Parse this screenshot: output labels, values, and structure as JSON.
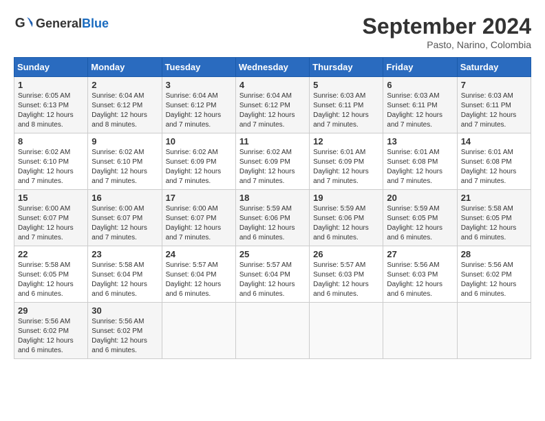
{
  "logo": {
    "general": "General",
    "blue": "Blue"
  },
  "title": "September 2024",
  "subtitle": "Pasto, Narino, Colombia",
  "days_of_week": [
    "Sunday",
    "Monday",
    "Tuesday",
    "Wednesday",
    "Thursday",
    "Friday",
    "Saturday"
  ],
  "weeks": [
    [
      {
        "day": "1",
        "sunrise": "6:05 AM",
        "sunset": "6:13 PM",
        "daylight": "12 hours and 8 minutes."
      },
      {
        "day": "2",
        "sunrise": "6:04 AM",
        "sunset": "6:12 PM",
        "daylight": "12 hours and 8 minutes."
      },
      {
        "day": "3",
        "sunrise": "6:04 AM",
        "sunset": "6:12 PM",
        "daylight": "12 hours and 7 minutes."
      },
      {
        "day": "4",
        "sunrise": "6:04 AM",
        "sunset": "6:12 PM",
        "daylight": "12 hours and 7 minutes."
      },
      {
        "day": "5",
        "sunrise": "6:03 AM",
        "sunset": "6:11 PM",
        "daylight": "12 hours and 7 minutes."
      },
      {
        "day": "6",
        "sunrise": "6:03 AM",
        "sunset": "6:11 PM",
        "daylight": "12 hours and 7 minutes."
      },
      {
        "day": "7",
        "sunrise": "6:03 AM",
        "sunset": "6:11 PM",
        "daylight": "12 hours and 7 minutes."
      }
    ],
    [
      {
        "day": "8",
        "sunrise": "6:02 AM",
        "sunset": "6:10 PM",
        "daylight": "12 hours and 7 minutes."
      },
      {
        "day": "9",
        "sunrise": "6:02 AM",
        "sunset": "6:10 PM",
        "daylight": "12 hours and 7 minutes."
      },
      {
        "day": "10",
        "sunrise": "6:02 AM",
        "sunset": "6:09 PM",
        "daylight": "12 hours and 7 minutes."
      },
      {
        "day": "11",
        "sunrise": "6:02 AM",
        "sunset": "6:09 PM",
        "daylight": "12 hours and 7 minutes."
      },
      {
        "day": "12",
        "sunrise": "6:01 AM",
        "sunset": "6:09 PM",
        "daylight": "12 hours and 7 minutes."
      },
      {
        "day": "13",
        "sunrise": "6:01 AM",
        "sunset": "6:08 PM",
        "daylight": "12 hours and 7 minutes."
      },
      {
        "day": "14",
        "sunrise": "6:01 AM",
        "sunset": "6:08 PM",
        "daylight": "12 hours and 7 minutes."
      }
    ],
    [
      {
        "day": "15",
        "sunrise": "6:00 AM",
        "sunset": "6:07 PM",
        "daylight": "12 hours and 7 minutes."
      },
      {
        "day": "16",
        "sunrise": "6:00 AM",
        "sunset": "6:07 PM",
        "daylight": "12 hours and 7 minutes."
      },
      {
        "day": "17",
        "sunrise": "6:00 AM",
        "sunset": "6:07 PM",
        "daylight": "12 hours and 7 minutes."
      },
      {
        "day": "18",
        "sunrise": "5:59 AM",
        "sunset": "6:06 PM",
        "daylight": "12 hours and 6 minutes."
      },
      {
        "day": "19",
        "sunrise": "5:59 AM",
        "sunset": "6:06 PM",
        "daylight": "12 hours and 6 minutes."
      },
      {
        "day": "20",
        "sunrise": "5:59 AM",
        "sunset": "6:05 PM",
        "daylight": "12 hours and 6 minutes."
      },
      {
        "day": "21",
        "sunrise": "5:58 AM",
        "sunset": "6:05 PM",
        "daylight": "12 hours and 6 minutes."
      }
    ],
    [
      {
        "day": "22",
        "sunrise": "5:58 AM",
        "sunset": "6:05 PM",
        "daylight": "12 hours and 6 minutes."
      },
      {
        "day": "23",
        "sunrise": "5:58 AM",
        "sunset": "6:04 PM",
        "daylight": "12 hours and 6 minutes."
      },
      {
        "day": "24",
        "sunrise": "5:57 AM",
        "sunset": "6:04 PM",
        "daylight": "12 hours and 6 minutes."
      },
      {
        "day": "25",
        "sunrise": "5:57 AM",
        "sunset": "6:04 PM",
        "daylight": "12 hours and 6 minutes."
      },
      {
        "day": "26",
        "sunrise": "5:57 AM",
        "sunset": "6:03 PM",
        "daylight": "12 hours and 6 minutes."
      },
      {
        "day": "27",
        "sunrise": "5:56 AM",
        "sunset": "6:03 PM",
        "daylight": "12 hours and 6 minutes."
      },
      {
        "day": "28",
        "sunrise": "5:56 AM",
        "sunset": "6:02 PM",
        "daylight": "12 hours and 6 minutes."
      }
    ],
    [
      {
        "day": "29",
        "sunrise": "5:56 AM",
        "sunset": "6:02 PM",
        "daylight": "12 hours and 6 minutes."
      },
      {
        "day": "30",
        "sunrise": "5:56 AM",
        "sunset": "6:02 PM",
        "daylight": "12 hours and 6 minutes."
      },
      null,
      null,
      null,
      null,
      null
    ]
  ]
}
